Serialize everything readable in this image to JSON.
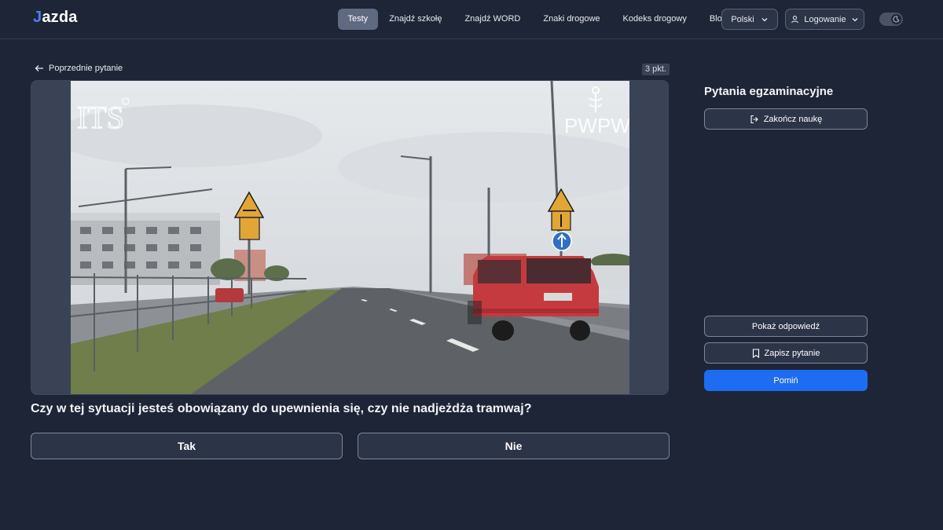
{
  "app": {
    "logo": "Jazda",
    "logo_mark": "J",
    "logo_rest": "azda"
  },
  "nav": {
    "items": [
      {
        "label": "Testy",
        "active": true
      },
      {
        "label": "Znajdź szkołę",
        "active": false
      },
      {
        "label": "Znajdź WORD",
        "active": false
      },
      {
        "label": "Znaki drogowe",
        "active": false
      },
      {
        "label": "Kodeks drogowy",
        "active": false
      },
      {
        "label": "Blog",
        "active": false
      }
    ],
    "language": "Polski",
    "login": "Logowanie"
  },
  "question": {
    "prev_label": "Poprzednie pytanie",
    "points": "3 pkt.",
    "text": "Czy w tej sytuacji jesteś obowiązany do upewnienia się, czy nie nadjeżdża tramwaj?",
    "answers": [
      "Tak",
      "Nie"
    ],
    "watermarks": [
      "ITS",
      "PWPW"
    ]
  },
  "sidebar": {
    "title": "Pytania egzaminacyjne",
    "end_label": "Zakończ naukę",
    "show_label": "Pokaż odpowiedź",
    "save_label": "Zapisz pytanie",
    "skip_label": "Pomiń"
  },
  "colors": {
    "accent": "#1d6cf2",
    "background": "#1e2536",
    "logo_mark": "#4f7df5"
  },
  "icons": [
    "arrow-left-icon",
    "chevron-down-icon",
    "user-icon",
    "moon-icon",
    "logout-icon",
    "bookmark-icon"
  ]
}
